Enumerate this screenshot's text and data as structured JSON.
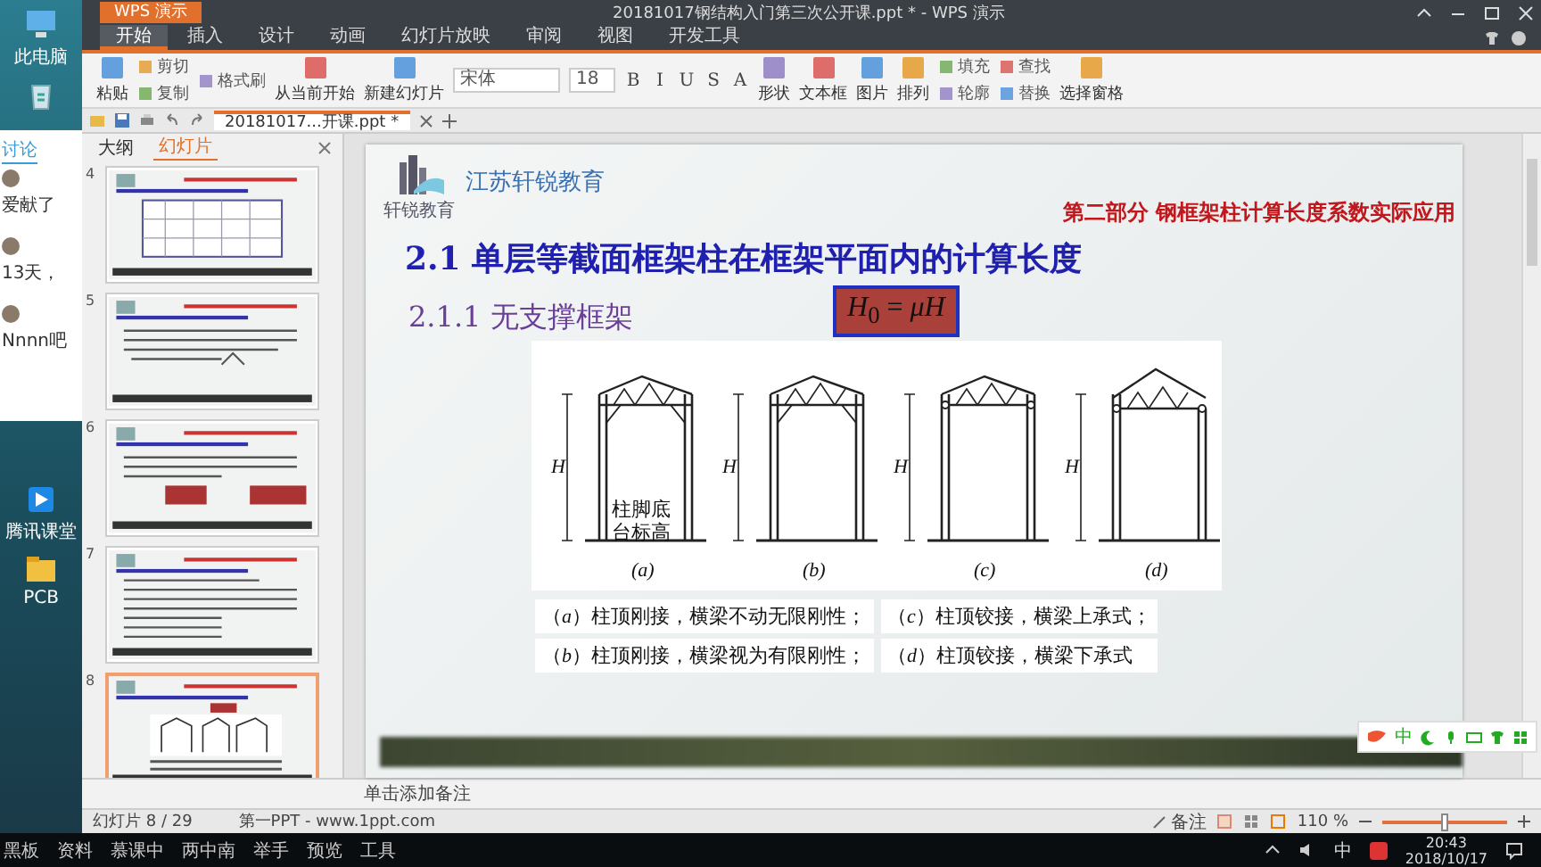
{
  "desktop": {
    "icons": [
      {
        "label": "此电脑",
        "kind": "computer"
      },
      {
        "label": "腾讯课堂",
        "kind": "app"
      },
      {
        "label": "PCB",
        "kind": "folder"
      }
    ]
  },
  "chat": {
    "tab": "讨论",
    "messages": [
      "爱献了",
      "13天，",
      "Nnnn吧"
    ]
  },
  "window": {
    "app_button": "WPS 演示",
    "title": "20181017钢结构入门第三次公开课.ppt * - WPS 演示"
  },
  "menu_tabs": [
    {
      "label": "开始",
      "selected": true
    },
    {
      "label": "插入",
      "selected": false
    },
    {
      "label": "设计",
      "selected": false
    },
    {
      "label": "动画",
      "selected": false
    },
    {
      "label": "幻灯片放映",
      "selected": false
    },
    {
      "label": "审阅",
      "selected": false
    },
    {
      "label": "视图",
      "selected": false
    },
    {
      "label": "开发工具",
      "selected": false
    }
  ],
  "ribbon": {
    "items": [
      {
        "kind": "large",
        "label": "粘贴"
      },
      {
        "kind": "small",
        "label": "剪切"
      },
      {
        "kind": "small",
        "label": "复制"
      },
      {
        "kind": "small",
        "label": "格式刷"
      },
      {
        "kind": "large",
        "label": "从当前开始"
      },
      {
        "kind": "large",
        "label": "新建幻灯片"
      },
      {
        "kind": "field",
        "label": "宋体"
      },
      {
        "kind": "field",
        "label": "18"
      },
      {
        "kind": "format",
        "label": "B"
      },
      {
        "kind": "format",
        "label": "I"
      },
      {
        "kind": "format",
        "label": "U"
      },
      {
        "kind": "format",
        "label": "S"
      },
      {
        "kind": "format",
        "label": "A"
      },
      {
        "kind": "large",
        "label": "形状"
      },
      {
        "kind": "large",
        "label": "文本框"
      },
      {
        "kind": "large",
        "label": "图片"
      },
      {
        "kind": "large",
        "label": "排列"
      },
      {
        "kind": "small",
        "label": "填充"
      },
      {
        "kind": "small",
        "label": "轮廓"
      },
      {
        "kind": "small",
        "label": "查找"
      },
      {
        "kind": "small",
        "label": "替换"
      },
      {
        "kind": "large",
        "label": "选择窗格"
      }
    ]
  },
  "doc_tabs": [
    {
      "label": "20181017...开课.ppt *",
      "selected": true
    }
  ],
  "pane_tabs": [
    {
      "label": "大纲",
      "selected": false
    },
    {
      "label": "幻灯片",
      "selected": true
    }
  ],
  "thumbnails": [
    {
      "number": "4",
      "kind": "table",
      "selected": false
    },
    {
      "number": "5",
      "kind": "text",
      "selected": false
    },
    {
      "number": "6",
      "kind": "boxes",
      "selected": false
    },
    {
      "number": "7",
      "kind": "bullets",
      "selected": false
    },
    {
      "number": "8",
      "kind": "frames",
      "selected": true
    }
  ],
  "slide": {
    "logo_text": "轩锐教育",
    "company": "江苏轩锐教育",
    "section_title": "第二部分 钢框架柱计算长度系数实际应用",
    "heading": "2.1 单层等截面框架柱在框架平面内的计算长度",
    "subheading": "2.1.1 无支撑框架",
    "formula": "*H*$_{0}$ = *μH*",
    "diagram": {
      "frames": [
        {
          "label": "(a)",
          "height_label": "H",
          "kind": "rigid"
        },
        {
          "label": "(b)",
          "height_label": "H",
          "kind": "rigid"
        },
        {
          "label": "(c)",
          "height_label": "H",
          "kind": "pinned"
        },
        {
          "label": "(d)",
          "height_label": "H",
          "kind": "pinned_under"
        }
      ],
      "base_label": [
        "柱脚底",
        "台标高"
      ]
    },
    "captions": [
      "（*a*）柱顶刚接，横梁不动无限刚性；",
      "（*c*）柱顶铰接，横梁上承式；",
      "（*b*）柱顶刚接，横梁视为有限刚性；",
      "（*d*）柱顶铰接，横梁下承式"
    ]
  },
  "notes": {
    "placeholder": "单击添加备注"
  },
  "ime_toolbar": {
    "mode": "中"
  },
  "status_bar": {
    "slide_counter": "幻灯片 8 / 29",
    "theme": "第一PPT - www.1ppt.com",
    "notes_button": "备注",
    "zoom_text": "110 %",
    "zoom": {
      "level": 0.5
    }
  },
  "taskbar": {
    "tools": [
      "黑板",
      "资料",
      "慕课中",
      "两中南",
      "举手",
      "预览",
      "工具"
    ],
    "ime": "中",
    "time": "20:43",
    "date": "2018/10/17"
  }
}
